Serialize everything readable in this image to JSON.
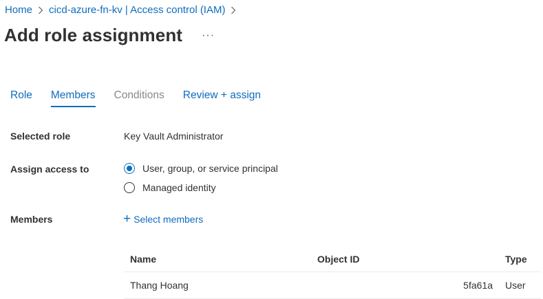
{
  "breadcrumb": {
    "home": "Home",
    "resource": "cicd-azure-fn-kv | Access control (IAM)"
  },
  "page": {
    "title": "Add role assignment",
    "more": "···"
  },
  "tabs": [
    {
      "label": "Role",
      "state": "normal"
    },
    {
      "label": "Members",
      "state": "selected"
    },
    {
      "label": "Conditions",
      "state": "disabled"
    },
    {
      "label": "Review + assign",
      "state": "normal"
    }
  ],
  "form": {
    "selected_role_label": "Selected role",
    "selected_role_value": "Key Vault Administrator",
    "assign_access_label": "Assign access to",
    "assign_options": [
      {
        "label": "User, group, or service principal",
        "checked": true
      },
      {
        "label": "Managed identity",
        "checked": false
      }
    ],
    "members_label": "Members",
    "select_members": "Select members"
  },
  "members_table": {
    "columns": [
      "Name",
      "Object ID",
      "Type"
    ],
    "rows": [
      {
        "name": "Thang Hoang",
        "object_id": "5fa61a",
        "type": "User"
      }
    ]
  },
  "colors": {
    "accent": "#0f6cbd",
    "text": "#323130",
    "disabled": "#8a8886",
    "divider": "#edebe9"
  }
}
